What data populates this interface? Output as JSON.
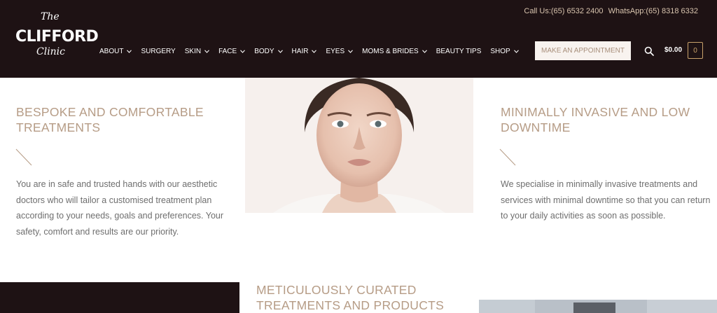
{
  "header": {
    "logo": {
      "the": "The",
      "main": "CLIFFORD",
      "clinic": "Clinic"
    },
    "contact": {
      "call": "Call Us:(65) 6532 2400",
      "whatsapp": "WhatsApp:(65) 8318 6332"
    },
    "nav": [
      {
        "label": "ABOUT",
        "has_dropdown": true
      },
      {
        "label": "SURGERY",
        "has_dropdown": false
      },
      {
        "label": "SKIN",
        "has_dropdown": true
      },
      {
        "label": "FACE",
        "has_dropdown": true
      },
      {
        "label": "BODY",
        "has_dropdown": true
      },
      {
        "label": "HAIR",
        "has_dropdown": true
      },
      {
        "label": "EYES",
        "has_dropdown": true
      },
      {
        "label": "MOMS & BRIDES",
        "has_dropdown": true
      },
      {
        "label": "BEAUTY TIPS",
        "has_dropdown": false
      },
      {
        "label": "SHOP",
        "has_dropdown": true
      }
    ],
    "appointment_label": "MAKE AN APPOINTMENT",
    "cart_total": "$0.00",
    "cart_count": "0"
  },
  "features": {
    "left": {
      "heading": "BESPOKE AND COMFORTABLE TREATMENTS",
      "text": "You are in safe and trusted hands with our aesthetic doctors who will tailor a customised treatment plan according to your needs, goals and preferences. Your safety, comfort and results are our priority."
    },
    "right": {
      "heading": "MINIMALLY INVASIVE AND LOW DOWNTIME",
      "text": "We specialise in minimally invasive treatments and services with minimal downtime so that you can return to your daily activities as soon as possible."
    },
    "bottom": {
      "heading": "METICULOUSLY CURATED TREATMENTS AND PRODUCTS"
    }
  },
  "colors": {
    "header_bg": "#1e1214",
    "accent": "#b69c86",
    "cart_accent": "#c9a26b"
  }
}
